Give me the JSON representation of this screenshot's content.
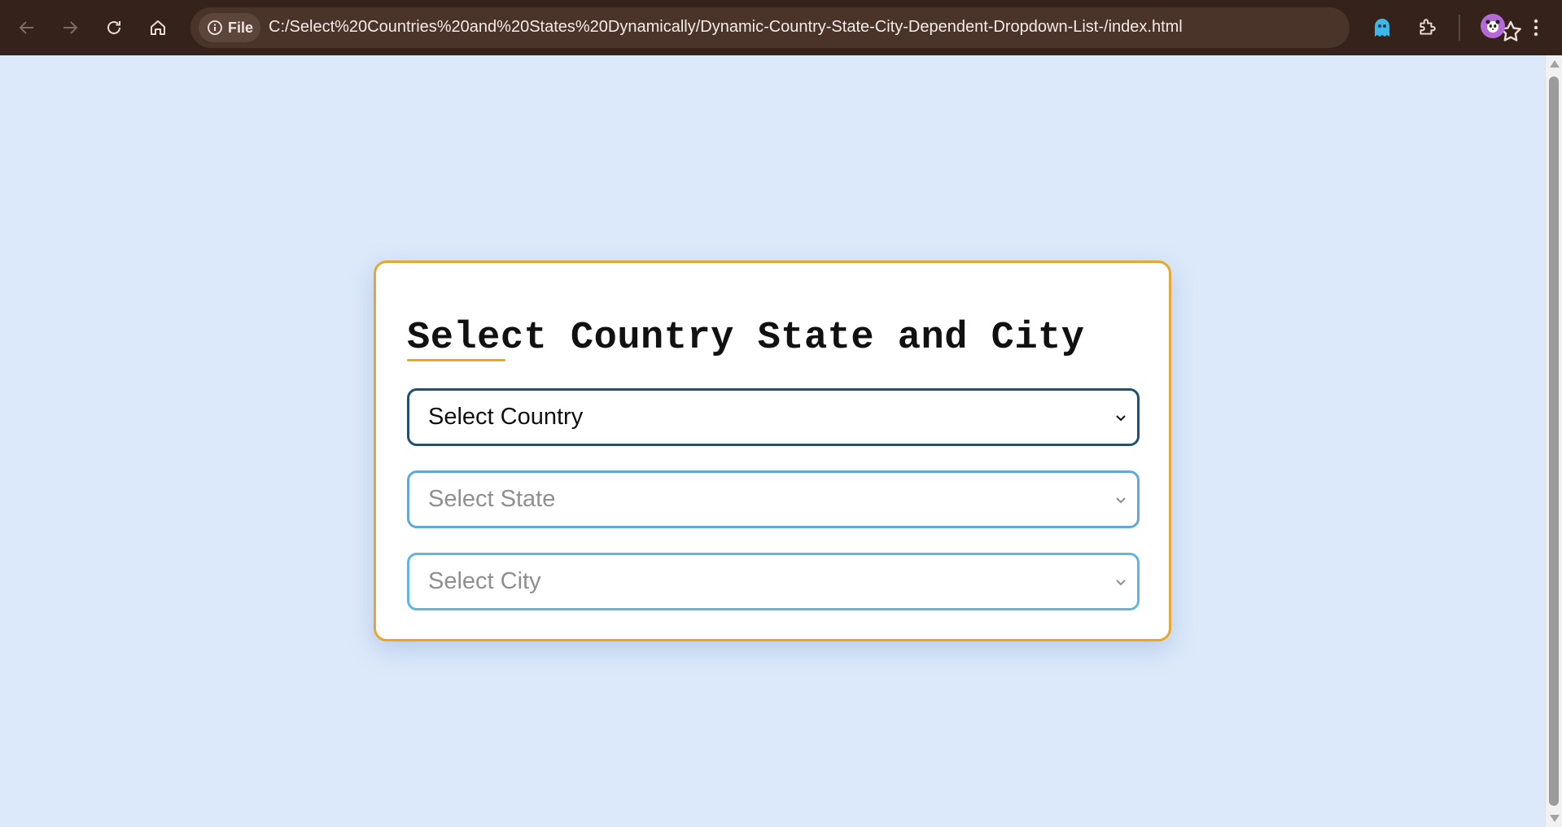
{
  "browser": {
    "page_info_label": "File",
    "url": "C:/Select%20Countries%20and%20States%20Dynamically/Dynamic-Country-State-City-Dependent-Dropdown-List-/index.html"
  },
  "colors": {
    "page_background": "#dce9fb",
    "card_border": "#e8a72b",
    "country_border": "#1f5170",
    "state_border": "#60a8d9",
    "city_border": "#5cb8e0"
  },
  "form": {
    "title": "Select Country State and City",
    "country_select": {
      "selected": "Select Country"
    },
    "state_select": {
      "selected": "Select State"
    },
    "city_select": {
      "selected": "Select City"
    }
  }
}
